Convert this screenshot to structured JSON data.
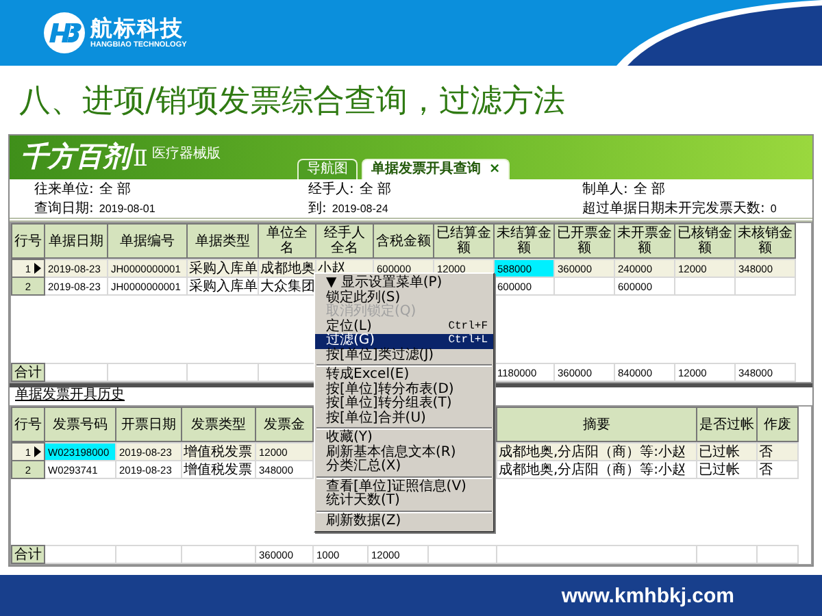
{
  "banner": {
    "brand": "航标科技",
    "tagline": "HANGBIAO TECHNOLOGY"
  },
  "title": "八、进项/销项发票综合查询，过滤方法",
  "app": {
    "product": "千方百剂",
    "version": "Ⅱ",
    "edition": "医疗器械版",
    "tabs": [
      {
        "label": "导航图",
        "selected": false
      },
      {
        "label": "单据发票开具查询",
        "selected": true,
        "close": "×"
      }
    ],
    "filters": [
      [
        {
          "label": "往来单位:",
          "value": "全 部"
        },
        {
          "label": "经手人:",
          "value": "全 部"
        },
        {
          "label": "制单人:",
          "value": "全 部"
        }
      ],
      [
        {
          "label": "查询日期:",
          "value": "2019-08-01"
        },
        {
          "label": "到:",
          "value": "2019-08-24"
        },
        {
          "label": "超过单据日期未开完发票天数:",
          "value": "0"
        }
      ]
    ],
    "grid": {
      "columns": [
        "行号",
        "单据日期",
        "单据编号",
        "单据类型",
        "单位全名",
        "经手人全名",
        "含税金额",
        "已结算金额",
        "未结算金额",
        "已开票金额",
        "未开票金额",
        "已核销金额",
        "未核销金额"
      ],
      "rows": [
        {
          "kind": "data",
          "selected": true,
          "cells": [
            "1",
            "2019-08-23",
            "JH0000000001",
            "采购入库单",
            "成都地奥",
            "小赵",
            "600000",
            "12000",
            {
              "text": "588000",
              "focused": true
            },
            "360000",
            "240000",
            "12000",
            "348000"
          ]
        },
        {
          "kind": "data",
          "selected": false,
          "cells": [
            "2",
            "2019-08-23",
            "JH0000000001",
            "采购入库单",
            "大众集团",
            "",
            "",
            "",
            "600000",
            "",
            "600000",
            "",
            ""
          ]
        },
        {
          "kind": "total",
          "selected": false,
          "cells": [
            "合计",
            "",
            "",
            "",
            "",
            "",
            "",
            "",
            "1180000",
            "360000",
            "840000",
            "12000",
            "348000"
          ]
        }
      ]
    },
    "history": {
      "title": "单据发票开具历史",
      "columns": [
        "行号",
        "发票号码",
        "开票日期",
        "发票类型",
        "发票金",
        "",
        "",
        "",
        "摘要",
        "是否过帐",
        "作废"
      ],
      "rows": [
        {
          "kind": "data",
          "selected": true,
          "cells": [
            "1",
            {
              "text": "W023198000",
              "focused": true
            },
            "2019-08-23",
            "增值税发票",
            "12000",
            "",
            "",
            "",
            "成都地奥,分店阳（商）等:小赵",
            "已过帐",
            "否"
          ]
        },
        {
          "kind": "data",
          "selected": false,
          "cells": [
            "2",
            "W0293741",
            "2019-08-23",
            "增值税发票",
            "348000",
            "",
            "",
            "",
            "成都地奥,分店阳（商）等:小赵",
            "已过帐",
            "否"
          ]
        },
        {
          "kind": "total",
          "selected": false,
          "cells": [
            "合计",
            "",
            "",
            "",
            "360000",
            "1000",
            "12000",
            "",
            "",
            "",
            ""
          ]
        }
      ]
    },
    "context_menu": [
      {
        "kind": "item",
        "label": "▼ 显示设置菜单(P)",
        "disabled": false,
        "selected": false
      },
      {
        "kind": "item",
        "label": "锁定此列(S)",
        "disabled": false,
        "selected": false
      },
      {
        "kind": "item",
        "label": "取消列锁定(Q)",
        "disabled": true,
        "selected": false
      },
      {
        "kind": "item",
        "label": "定位(L)",
        "shortcut": "Ctrl+F",
        "disabled": false,
        "selected": false
      },
      {
        "kind": "item",
        "label": "过滤(G)",
        "shortcut": "Ctrl+L",
        "disabled": false,
        "selected": true
      },
      {
        "kind": "item",
        "label": "按[单位]类过滤(J)",
        "disabled": false,
        "selected": false
      },
      {
        "kind": "separator"
      },
      {
        "kind": "item",
        "label": "转成Excel(E)",
        "disabled": false,
        "selected": false
      },
      {
        "kind": "item",
        "label": "按[单位]转分布表(D)",
        "disabled": false,
        "selected": false
      },
      {
        "kind": "item",
        "label": "按[单位]转分组表(T)",
        "disabled": false,
        "selected": false
      },
      {
        "kind": "item",
        "label": "按[单位]合并(U)",
        "disabled": false,
        "selected": false
      },
      {
        "kind": "separator"
      },
      {
        "kind": "item",
        "label": "收藏(Y)",
        "disabled": false,
        "selected": false
      },
      {
        "kind": "item",
        "label": "刷新基本信息文本(R)",
        "disabled": false,
        "selected": false
      },
      {
        "kind": "item",
        "label": "分类汇总(X)",
        "disabled": false,
        "selected": false
      },
      {
        "kind": "separator"
      },
      {
        "kind": "item",
        "label": "查看[单位]证照信息(V)",
        "disabled": false,
        "selected": false
      },
      {
        "kind": "item",
        "label": "统计天数(T)",
        "disabled": false,
        "selected": false
      },
      {
        "kind": "separator"
      },
      {
        "kind": "item",
        "label": "刷新数据(Z)",
        "disabled": false,
        "selected": false
      }
    ]
  },
  "footer": {
    "url": "www.kmhbkj.com"
  }
}
